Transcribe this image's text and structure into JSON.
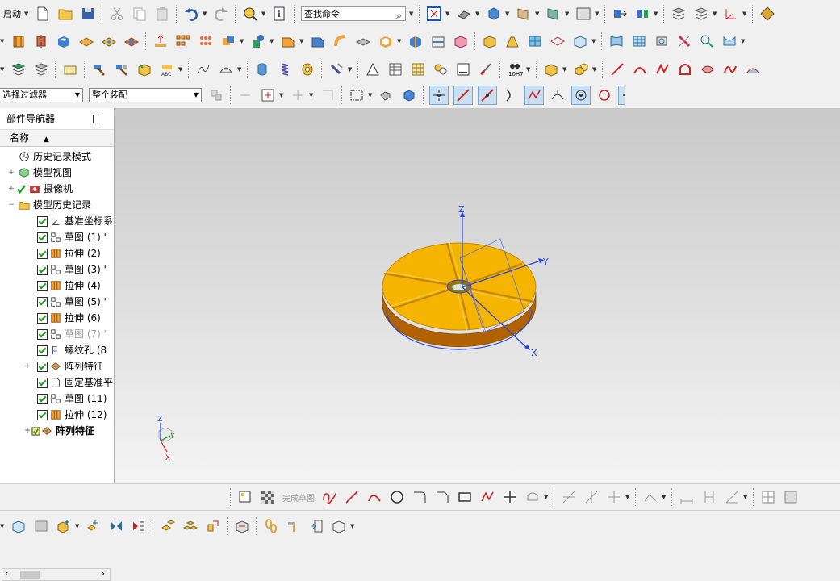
{
  "toolbar": {
    "start_label": "启动",
    "search_placeholder": "查找命令",
    "selection_filter": "选择过滤器",
    "assembly_scope": "整个装配"
  },
  "navigator": {
    "title": "部件导航器",
    "column_header": "名称",
    "items": [
      {
        "label": "历史记录模式",
        "icon": "clock-icon"
      },
      {
        "label": "模型视图",
        "icon": "model-views-icon"
      },
      {
        "label": "摄像机",
        "icon": "camera-icon"
      },
      {
        "label": "模型历史记录",
        "icon": "folder-icon"
      },
      {
        "label": "基准坐标系",
        "icon": "datum-csys-icon"
      },
      {
        "label": "草图 (1) \"",
        "icon": "sketch-icon"
      },
      {
        "label": "拉伸 (2)",
        "icon": "extrude-icon"
      },
      {
        "label": "草图 (3) \"",
        "icon": "sketch-icon"
      },
      {
        "label": "拉伸 (4)",
        "icon": "extrude-icon"
      },
      {
        "label": "草图 (5) \"",
        "icon": "sketch-icon"
      },
      {
        "label": "拉伸 (6)",
        "icon": "extrude-icon"
      },
      {
        "label": "草图 (7) \"",
        "icon": "sketch-icon"
      },
      {
        "label": "螺纹孔 (8",
        "icon": "threaded-hole-icon"
      },
      {
        "label": "阵列特征",
        "icon": "pattern-feature-icon"
      },
      {
        "label": "固定基准平",
        "icon": "datum-plane-icon"
      },
      {
        "label": "草图 (11)",
        "icon": "sketch-icon"
      },
      {
        "label": "拉伸 (12)",
        "icon": "extrude-icon"
      },
      {
        "label": "阵列特征",
        "icon": "pattern-feature-icon"
      }
    ]
  },
  "viewport": {
    "axis_labels": {
      "z": "Z",
      "y": "Y",
      "x": "X"
    },
    "triad_labels": {
      "z": "Z",
      "y": "Y",
      "x": "X"
    },
    "part_color": "#f5b400"
  },
  "sketch_bar": {
    "finish_sketch_label": "完成草图"
  }
}
